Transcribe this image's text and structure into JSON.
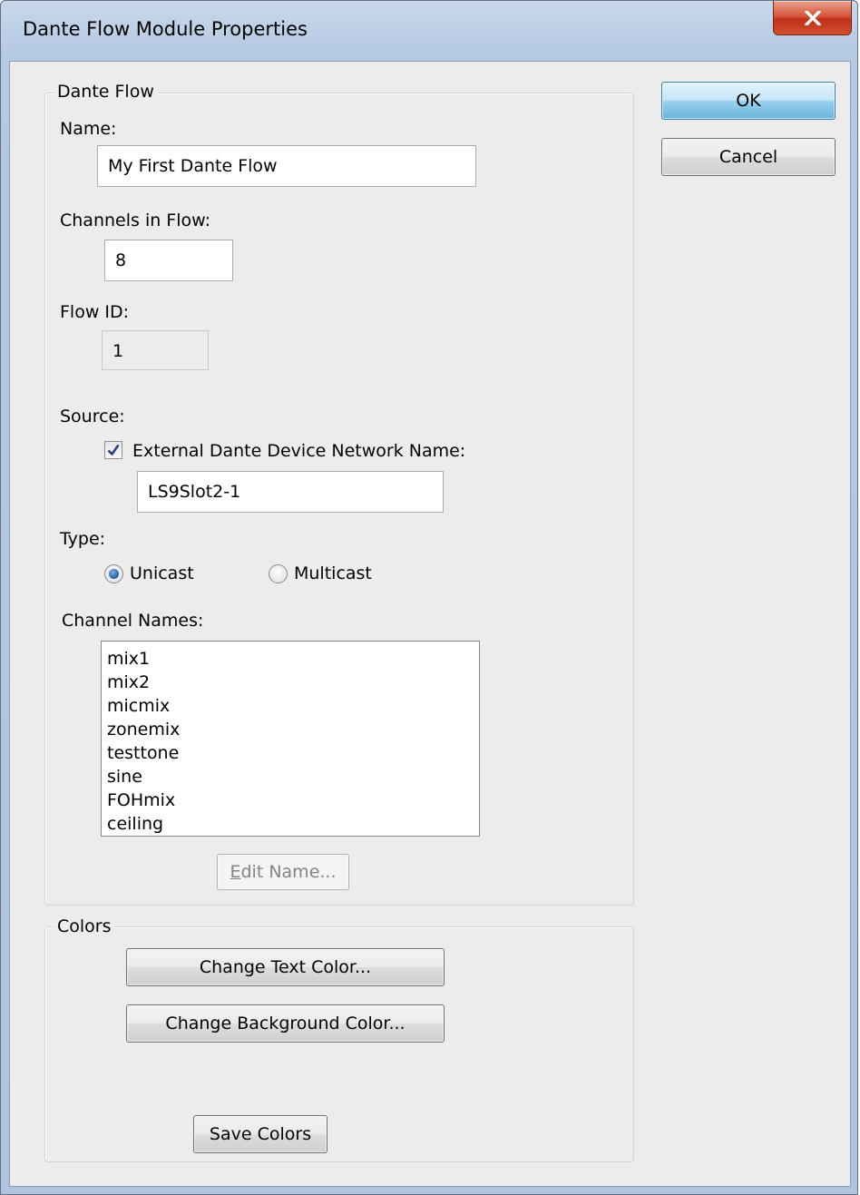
{
  "window": {
    "title": "Dante Flow Module Properties",
    "close_glyph": "X"
  },
  "buttons": {
    "ok": "OK",
    "cancel": "Cancel"
  },
  "dante_flow": {
    "group_title": "Dante Flow",
    "name_label": "Name:",
    "name_value": "My First Dante Flow",
    "channels_label": "Channels in Flow:",
    "channels_value": "8",
    "flow_id_label": "Flow ID:",
    "flow_id_value": "1",
    "source_label": "Source:",
    "external_checkbox_label": "External Dante Device Network Name:",
    "external_checked": true,
    "network_name_value": "LS9Slot2-1",
    "type_label": "Type:",
    "type_options": [
      "Unicast",
      "Multicast"
    ],
    "type_selected": "Unicast",
    "channel_names_label": "Channel Names:",
    "channel_names": [
      "mix1",
      "mix2",
      "micmix",
      "zonemix",
      "testtone",
      "sine",
      "FOHmix",
      "ceiling"
    ],
    "edit_name_button_mnemonic": "E",
    "edit_name_button_rest": "dit Name..."
  },
  "colors": {
    "group_title": "Colors",
    "change_text_color": "Change Text Color...",
    "change_background_color": "Change Background Color...",
    "save_colors": "Save Colors"
  }
}
